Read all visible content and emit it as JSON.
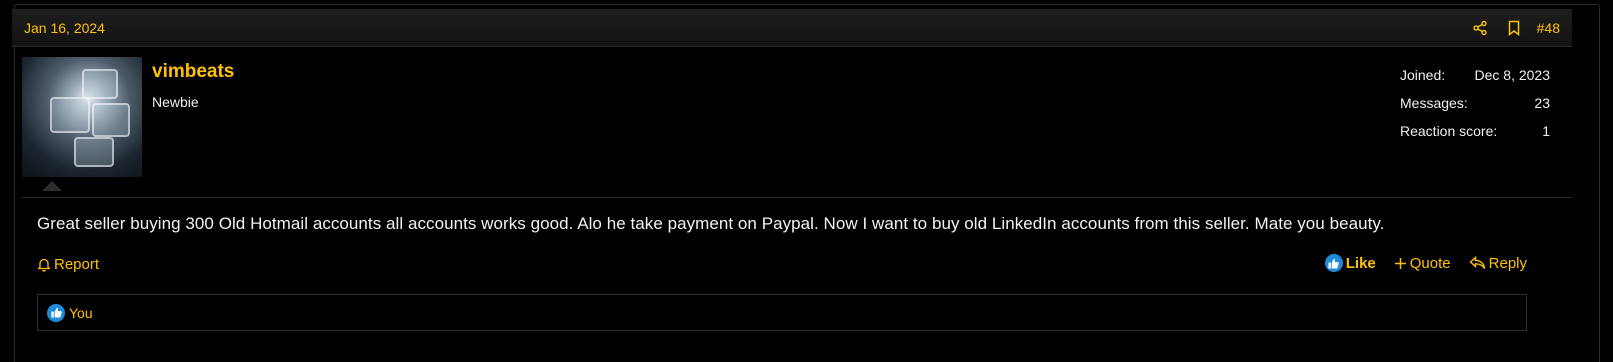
{
  "post": {
    "date": "Jan 16, 2024",
    "number": "#48",
    "body": "Great seller buying 300 Old Hotmail accounts all accounts works good. Alo he take payment on Paypal. Now I want to buy old LinkedIn accounts from this seller. Mate you beauty."
  },
  "user": {
    "name": "vimbeats",
    "title": "Newbie",
    "stats": [
      {
        "label": "Joined:",
        "value": "Dec 8, 2023"
      },
      {
        "label": "Messages:",
        "value": "23"
      },
      {
        "label": "Reaction score:",
        "value": "1"
      }
    ]
  },
  "actions": {
    "report": "Report",
    "like": "Like",
    "quote": "Quote",
    "reply": "Reply"
  },
  "reactions": {
    "users": "You"
  },
  "icons": {
    "share": "share-icon",
    "bookmark": "bookmark-icon",
    "bell": "bell-icon",
    "like": "thumbs-up-icon",
    "plus": "plus-icon",
    "reply": "reply-arrow-icon"
  },
  "colors": {
    "accent": "#ffc107",
    "background": "#000000",
    "like_blue": "#1f8bd8"
  }
}
